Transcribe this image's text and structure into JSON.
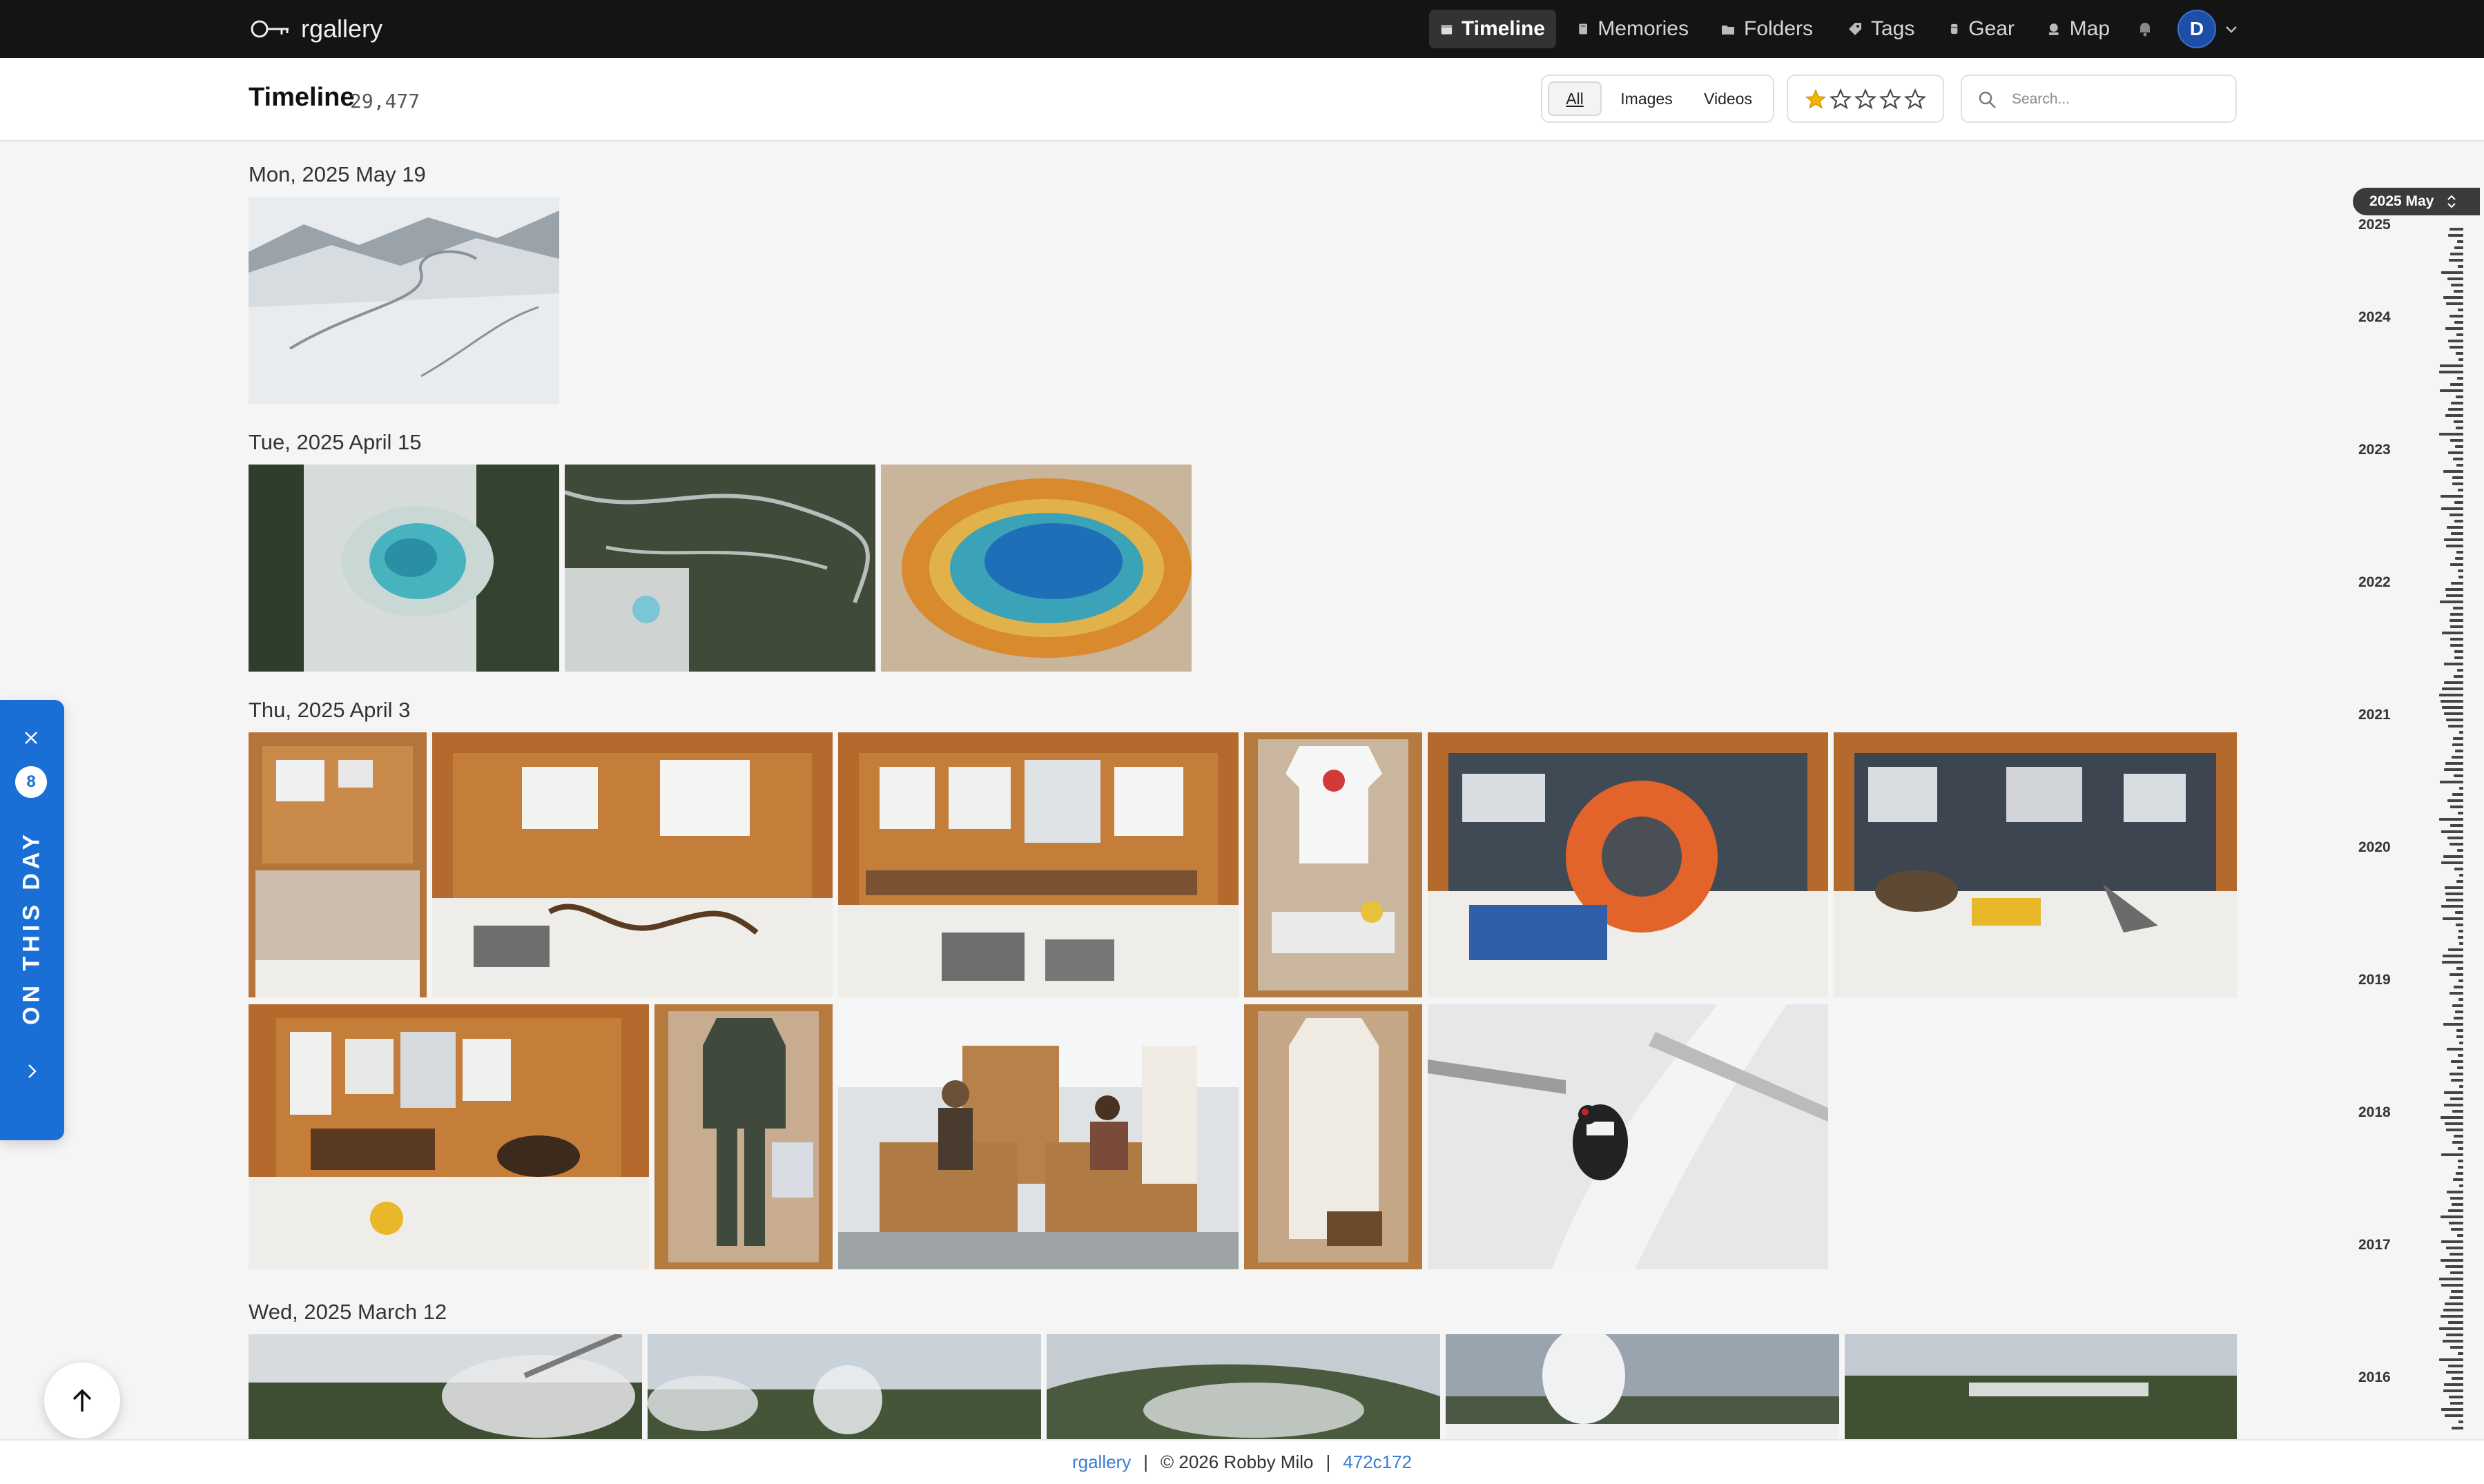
{
  "app": {
    "name": "rgallery",
    "logo_icon": "key-logo-icon"
  },
  "nav": {
    "items": [
      {
        "label": "Timeline",
        "icon": "calendar-icon",
        "active": true
      },
      {
        "label": "Memories",
        "icon": "book-icon"
      },
      {
        "label": "Folders",
        "icon": "folder-icon"
      },
      {
        "label": "Tags",
        "icon": "tag-icon"
      },
      {
        "label": "Gear",
        "icon": "camera-gear-icon"
      },
      {
        "label": "Map",
        "icon": "map-pin-icon"
      }
    ],
    "notifications_icon": "bell-icon",
    "user_initial": "D"
  },
  "header": {
    "title": "Timeline",
    "count": "29,477",
    "filters": [
      "All",
      "Images",
      "Videos"
    ],
    "selected_filter": "All",
    "rating_filter": {
      "filled": 1,
      "max": 5
    },
    "search_placeholder": "Search..."
  },
  "timeline": {
    "days": [
      {
        "label": "Mon, 2025 May 19",
        "photos": [
          {
            "subject": "snowy mountain road aerial"
          }
        ]
      },
      {
        "label": "Tue, 2025 April 15",
        "photos": [
          {
            "subject": "aerial hot spring in forest"
          },
          {
            "subject": "aerial geyser basin boardwalk"
          },
          {
            "subject": "grand prismatic spring aerial"
          }
        ]
      },
      {
        "label": "Thu, 2025 April 3",
        "photos": [
          {
            "subject": "museum display case with artifacts"
          },
          {
            "subject": "museum display with leather straps"
          },
          {
            "subject": "museum display with wooden skis and map"
          },
          {
            "subject": "display case with shirt"
          },
          {
            "subject": "display with orange life ring"
          },
          {
            "subject": "display with vintage car photos"
          },
          {
            "subject": "display with boots and sign"
          },
          {
            "subject": "display with green coveralls"
          },
          {
            "subject": "museum visitors at display cases"
          },
          {
            "subject": "display with white coat"
          },
          {
            "subject": "woodpecker on birch branch"
          }
        ]
      },
      {
        "label": "Wed, 2025 March 12",
        "photos": [
          {
            "subject": "geyser steam with pines"
          },
          {
            "subject": "geyser basin steam"
          },
          {
            "subject": "snowy geyser basin hillside"
          },
          {
            "subject": "erupting geyser plume"
          },
          {
            "subject": "forest and meadow panorama"
          }
        ]
      }
    ]
  },
  "scrubber": {
    "current": "2025 May",
    "years": [
      "2025",
      "2024",
      "2023",
      "2022",
      "2021",
      "2020",
      "2019",
      "2018",
      "2017",
      "2016"
    ]
  },
  "on_this_day": {
    "label": "ON THIS DAY",
    "count": "8"
  },
  "footer": {
    "app_link": "rgallery",
    "copyright": "© 2026 Robby Milo",
    "version": "472c172"
  }
}
